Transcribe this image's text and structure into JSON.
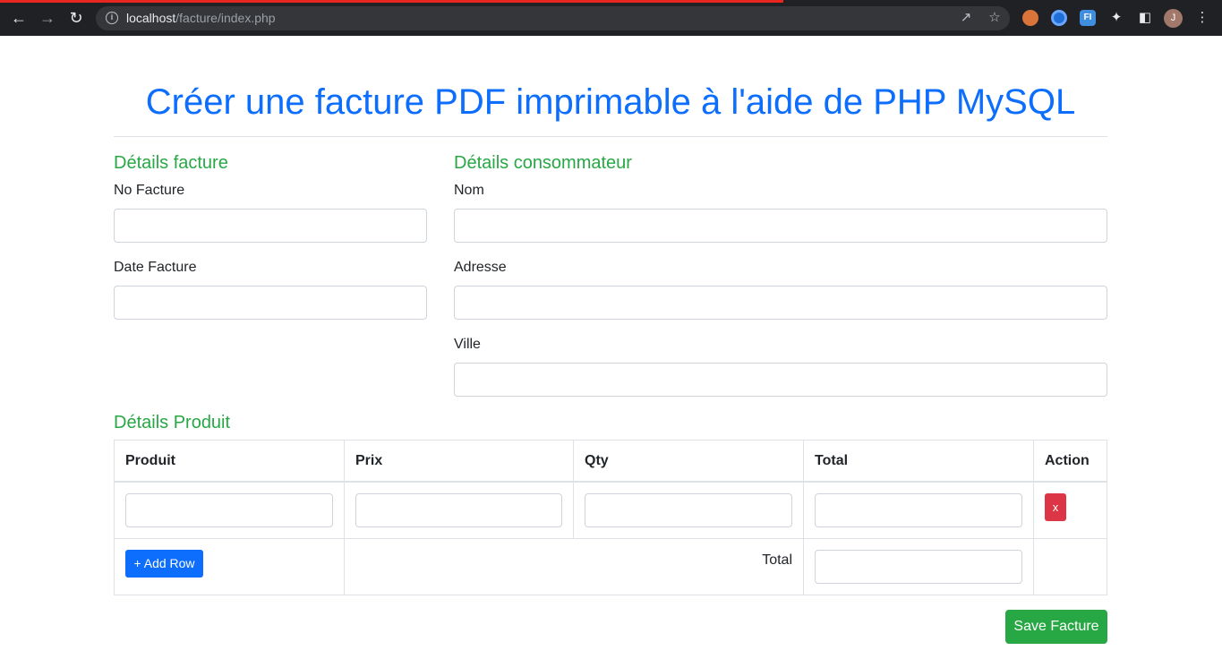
{
  "browser": {
    "url_host": "localhost",
    "url_path": "/facture/index.php",
    "avatar_letter": "J",
    "ext3_label": "FI",
    "icons": [
      "back-arrow-icon",
      "forward-arrow-icon",
      "reload-icon",
      "info-icon",
      "share-icon",
      "star-icon",
      "puzzle-icon",
      "sidepanel-icon",
      "kebab-menu-icon"
    ]
  },
  "page": {
    "title": "Créer une facture PDF imprimable à l'aide de PHP MySQL"
  },
  "invoice": {
    "heading": "Détails facture",
    "number_label": "No Facture",
    "date_label": "Date Facture"
  },
  "customer": {
    "heading": "Détails consommateur",
    "name_label": "Nom",
    "address_label": "Adresse",
    "city_label": "Ville"
  },
  "products": {
    "heading": "Détails Produit",
    "columns": [
      "Produit",
      "Prix",
      "Qty",
      "Total",
      "Action"
    ],
    "delete_label": "x",
    "add_row_label": "+ Add Row",
    "total_label": "Total"
  },
  "actions": {
    "save_label": "Save Facture"
  },
  "colors": {
    "title": "#0d6efd",
    "section": "#28a745",
    "danger": "#dc3545",
    "primary": "#0d6efd",
    "success": "#28a745"
  }
}
